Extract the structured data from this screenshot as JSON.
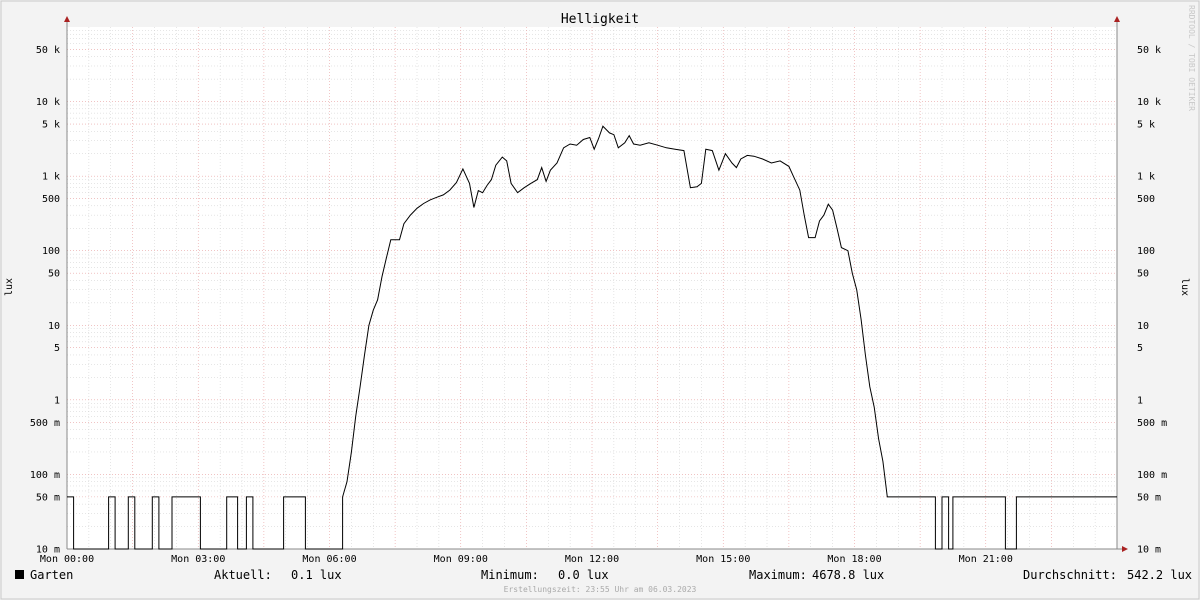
{
  "chart_data": {
    "type": "line",
    "title": "Helligkeit",
    "ylabel": "lux",
    "ylabel_right": "lux",
    "y_scale": "log",
    "ylim": [
      0.01,
      100000
    ],
    "xlim": [
      0,
      24
    ],
    "x_unit": "hours",
    "x_ticks": [
      {
        "x": 0,
        "label": "Mon 00:00"
      },
      {
        "x": 3,
        "label": "Mon 03:00"
      },
      {
        "x": 6,
        "label": "Mon 06:00"
      },
      {
        "x": 9,
        "label": "Mon 09:00"
      },
      {
        "x": 12,
        "label": "Mon 12:00"
      },
      {
        "x": 15,
        "label": "Mon 15:00"
      },
      {
        "x": 18,
        "label": "Mon 18:00"
      },
      {
        "x": 21,
        "label": "Mon 21:00"
      }
    ],
    "y_ticks": [
      {
        "y": 0.01,
        "label": "10 m"
      },
      {
        "y": 0.05,
        "label": "50 m"
      },
      {
        "y": 0.1,
        "label": "100 m"
      },
      {
        "y": 0.5,
        "label": "500 m"
      },
      {
        "y": 1,
        "label": "1"
      },
      {
        "y": 5,
        "label": "5"
      },
      {
        "y": 10,
        "label": "10"
      },
      {
        "y": 50,
        "label": "50"
      },
      {
        "y": 100,
        "label": "100"
      },
      {
        "y": 500,
        "label": "500"
      },
      {
        "y": 1000,
        "label": "1 k"
      },
      {
        "y": 5000,
        "label": "5 k"
      },
      {
        "y": 10000,
        "label": "10 k"
      },
      {
        "y": 50000,
        "label": "50 k"
      }
    ],
    "grid": true,
    "series": [
      {
        "name": "Garten",
        "color": "#000000",
        "points": [
          [
            0.0,
            0.05
          ],
          [
            0.15,
            0.05
          ],
          [
            0.15,
            0.01
          ],
          [
            0.95,
            0.01
          ],
          [
            0.95,
            0.05
          ],
          [
            1.1,
            0.05
          ],
          [
            1.1,
            0.01
          ],
          [
            1.4,
            0.01
          ],
          [
            1.4,
            0.05
          ],
          [
            1.55,
            0.05
          ],
          [
            1.55,
            0.01
          ],
          [
            1.95,
            0.01
          ],
          [
            1.95,
            0.05
          ],
          [
            2.1,
            0.05
          ],
          [
            2.1,
            0.01
          ],
          [
            2.4,
            0.01
          ],
          [
            2.4,
            0.05
          ],
          [
            3.05,
            0.05
          ],
          [
            3.05,
            0.01
          ],
          [
            3.65,
            0.01
          ],
          [
            3.65,
            0.05
          ],
          [
            3.9,
            0.05
          ],
          [
            3.9,
            0.01
          ],
          [
            4.1,
            0.01
          ],
          [
            4.1,
            0.05
          ],
          [
            4.25,
            0.05
          ],
          [
            4.25,
            0.01
          ],
          [
            4.95,
            0.01
          ],
          [
            4.95,
            0.05
          ],
          [
            5.45,
            0.05
          ],
          [
            5.45,
            0.01
          ],
          [
            6.3,
            0.01
          ],
          [
            6.3,
            0.05
          ],
          [
            6.4,
            0.08
          ],
          [
            6.5,
            0.2
          ],
          [
            6.6,
            0.6
          ],
          [
            6.7,
            1.5
          ],
          [
            6.8,
            4
          ],
          [
            6.9,
            10
          ],
          [
            7.0,
            16
          ],
          [
            7.1,
            22
          ],
          [
            7.2,
            45
          ],
          [
            7.3,
            80
          ],
          [
            7.4,
            140
          ],
          [
            7.6,
            140
          ],
          [
            7.7,
            230
          ],
          [
            7.85,
            300
          ],
          [
            8.0,
            370
          ],
          [
            8.15,
            430
          ],
          [
            8.3,
            480
          ],
          [
            8.45,
            520
          ],
          [
            8.6,
            560
          ],
          [
            8.75,
            650
          ],
          [
            8.9,
            820
          ],
          [
            9.05,
            1250
          ],
          [
            9.2,
            800
          ],
          [
            9.3,
            380
          ],
          [
            9.4,
            640
          ],
          [
            9.5,
            600
          ],
          [
            9.6,
            750
          ],
          [
            9.7,
            900
          ],
          [
            9.8,
            1400
          ],
          [
            9.95,
            1800
          ],
          [
            10.05,
            1600
          ],
          [
            10.15,
            800
          ],
          [
            10.3,
            600
          ],
          [
            10.45,
            700
          ],
          [
            10.6,
            800
          ],
          [
            10.75,
            900
          ],
          [
            10.85,
            1300
          ],
          [
            10.95,
            850
          ],
          [
            11.05,
            1200
          ],
          [
            11.2,
            1500
          ],
          [
            11.35,
            2400
          ],
          [
            11.5,
            2700
          ],
          [
            11.65,
            2600
          ],
          [
            11.8,
            3100
          ],
          [
            11.95,
            3300
          ],
          [
            12.05,
            2300
          ],
          [
            12.15,
            3200
          ],
          [
            12.25,
            4678.8
          ],
          [
            12.4,
            3800
          ],
          [
            12.5,
            3600
          ],
          [
            12.6,
            2400
          ],
          [
            12.75,
            2800
          ],
          [
            12.85,
            3500
          ],
          [
            12.95,
            2700
          ],
          [
            13.1,
            2600
          ],
          [
            13.3,
            2800
          ],
          [
            13.5,
            2600
          ],
          [
            13.7,
            2400
          ],
          [
            13.9,
            2300
          ],
          [
            14.1,
            2200
          ],
          [
            14.25,
            700
          ],
          [
            14.4,
            720
          ],
          [
            14.5,
            800
          ],
          [
            14.6,
            2300
          ],
          [
            14.75,
            2200
          ],
          [
            14.9,
            1200
          ],
          [
            15.05,
            2000
          ],
          [
            15.2,
            1500
          ],
          [
            15.3,
            1300
          ],
          [
            15.4,
            1700
          ],
          [
            15.55,
            1900
          ],
          [
            15.7,
            1850
          ],
          [
            15.9,
            1700
          ],
          [
            16.1,
            1500
          ],
          [
            16.3,
            1600
          ],
          [
            16.5,
            1350
          ],
          [
            16.6,
            1000
          ],
          [
            16.75,
            650
          ],
          [
            16.85,
            300
          ],
          [
            16.95,
            150
          ],
          [
            17.1,
            150
          ],
          [
            17.2,
            250
          ],
          [
            17.3,
            300
          ],
          [
            17.4,
            420
          ],
          [
            17.5,
            350
          ],
          [
            17.6,
            200
          ],
          [
            17.7,
            110
          ],
          [
            17.85,
            100
          ],
          [
            17.95,
            50
          ],
          [
            18.05,
            30
          ],
          [
            18.15,
            12
          ],
          [
            18.25,
            4
          ],
          [
            18.35,
            1.5
          ],
          [
            18.45,
            0.8
          ],
          [
            18.55,
            0.3
          ],
          [
            18.65,
            0.15
          ],
          [
            18.75,
            0.05
          ],
          [
            19.1,
            0.05
          ],
          [
            19.85,
            0.05
          ],
          [
            19.85,
            0.01
          ],
          [
            20.0,
            0.01
          ],
          [
            20.0,
            0.05
          ],
          [
            20.15,
            0.05
          ],
          [
            20.15,
            0.01
          ],
          [
            20.25,
            0.01
          ],
          [
            20.25,
            0.05
          ],
          [
            21.45,
            0.05
          ],
          [
            21.45,
            0.01
          ],
          [
            21.7,
            0.01
          ],
          [
            21.7,
            0.05
          ],
          [
            24.0,
            0.05
          ]
        ]
      }
    ]
  },
  "legend": {
    "series_name": "Garten",
    "swatch_color": "#000000",
    "aktuell_label": "Aktuell:",
    "aktuell_value": "0.1 lux",
    "minimum_label": "Minimum:",
    "minimum_value": "0.0 lux",
    "maximum_label": "Maximum:",
    "maximum_value": "4678.8 lux",
    "durchschnitt_label": "Durchschnitt:",
    "durchschnitt_value": "542.2 lux"
  },
  "footer": {
    "text": "Erstellungszeit: 23:55 Uhr am 06.03.2023"
  },
  "watermark": {
    "text": "RRDTOOL / TOBI OETIKER"
  },
  "colors": {
    "background": "#f3f3f3",
    "plot_background": "#ffffff",
    "major_grid": "#e8a0a0",
    "minor_grid": "#cccccc",
    "axis": "#888888",
    "arrow": "#aa2222"
  }
}
